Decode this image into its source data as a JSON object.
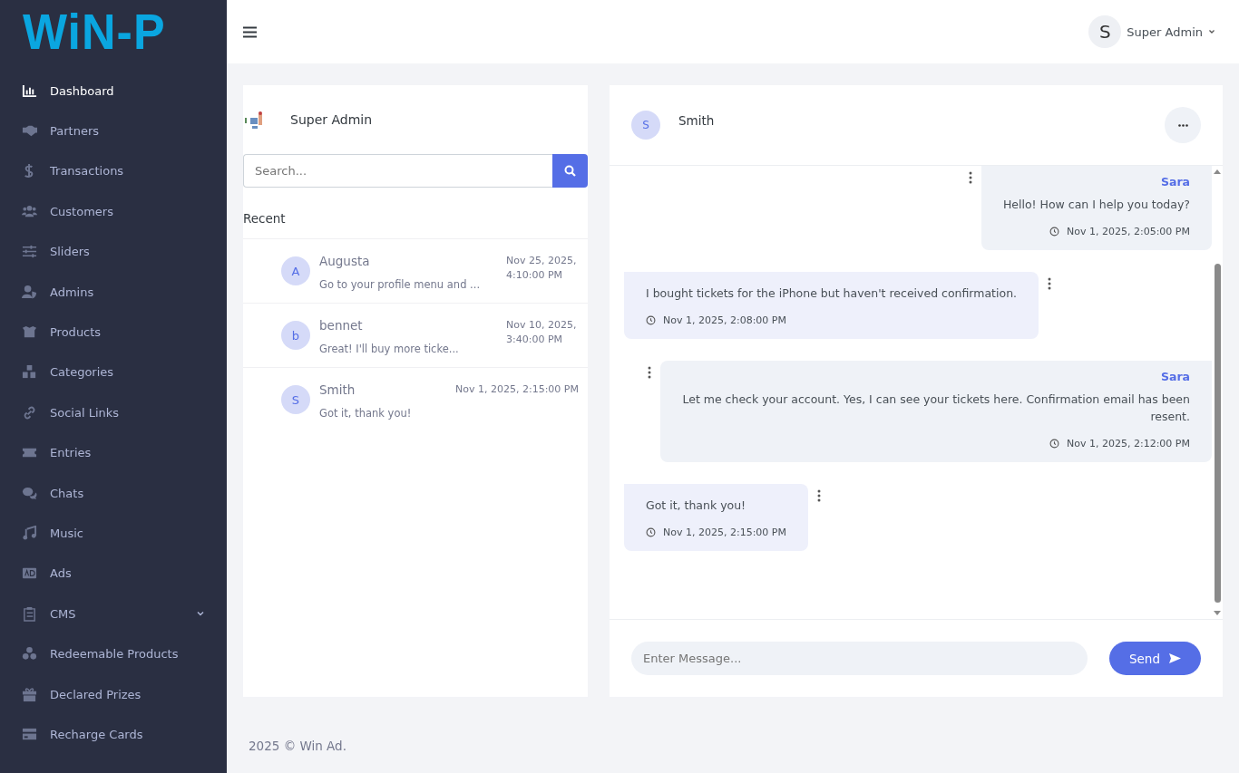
{
  "sidebar": {
    "logo": "WiN-P",
    "items": [
      {
        "label": "Dashboard",
        "selected": true,
        "kind": "link"
      },
      {
        "label": "Partners",
        "selected": false,
        "kind": "link"
      },
      {
        "label": "Transactions",
        "selected": false,
        "kind": "link"
      },
      {
        "label": "Customers",
        "selected": false,
        "kind": "link"
      },
      {
        "label": "Sliders",
        "selected": false,
        "kind": "link"
      },
      {
        "label": "Admins",
        "selected": false,
        "kind": "link"
      },
      {
        "label": "Products",
        "selected": false,
        "kind": "link"
      },
      {
        "label": "Categories",
        "selected": false,
        "kind": "link"
      },
      {
        "label": "Social Links",
        "selected": false,
        "kind": "link"
      },
      {
        "label": "Entries",
        "selected": false,
        "kind": "link"
      },
      {
        "label": "Chats",
        "selected": false,
        "kind": "link"
      },
      {
        "label": "Music",
        "selected": false,
        "kind": "link"
      },
      {
        "label": "Ads",
        "selected": false,
        "kind": "link"
      },
      {
        "label": "CMS",
        "selected": false,
        "kind": "group"
      },
      {
        "label": "Redeemable Products",
        "selected": false,
        "kind": "link"
      },
      {
        "label": "Declared Prizes",
        "selected": false,
        "kind": "link"
      },
      {
        "label": "Recharge Cards",
        "selected": false,
        "kind": "link"
      }
    ]
  },
  "topbar": {
    "user": {
      "initial": "S",
      "name": "Super Admin"
    }
  },
  "contacts": {
    "title": "Super Admin",
    "search": {
      "placeholder": "Search..."
    },
    "section": "Recent",
    "items": [
      {
        "initial": "A",
        "name": "Augusta",
        "preview": "Go to your profile menu and ...",
        "time": "Nov 25, 2025, 4:10:00 PM"
      },
      {
        "initial": "b",
        "name": "bennet",
        "preview": "Great! I'll buy more ticke...",
        "time": "Nov 10, 2025, 3:40:00 PM"
      },
      {
        "initial": "S",
        "name": "Smith",
        "preview": "Got it, thank you!",
        "time": "Nov 1, 2025, 2:15:00 PM"
      }
    ]
  },
  "chat": {
    "contact": {
      "initial": "S",
      "name": "Smith"
    },
    "messages": [
      {
        "kind": "sent",
        "sender": "Sara",
        "text": "Hello! How can I help you today?",
        "time": "Nov 1, 2025, 2:05:00 PM"
      },
      {
        "kind": "received",
        "text": "I bought tickets for the iPhone but haven't received confirmation.",
        "time": "Nov 1, 2025, 2:08:00 PM"
      },
      {
        "kind": "sent",
        "sender": "Sara",
        "text": "Let me check your account. Yes, I can see your tickets here. Confirmation email has been resent.",
        "time": "Nov 1, 2025, 2:12:00 PM"
      },
      {
        "kind": "received",
        "text": "Got it, thank you!",
        "time": "Nov 1, 2025, 2:15:00 PM"
      }
    ],
    "input": {
      "placeholder": "Enter Message..."
    },
    "send": "Send"
  },
  "footer": "2025 © Win Ad."
}
